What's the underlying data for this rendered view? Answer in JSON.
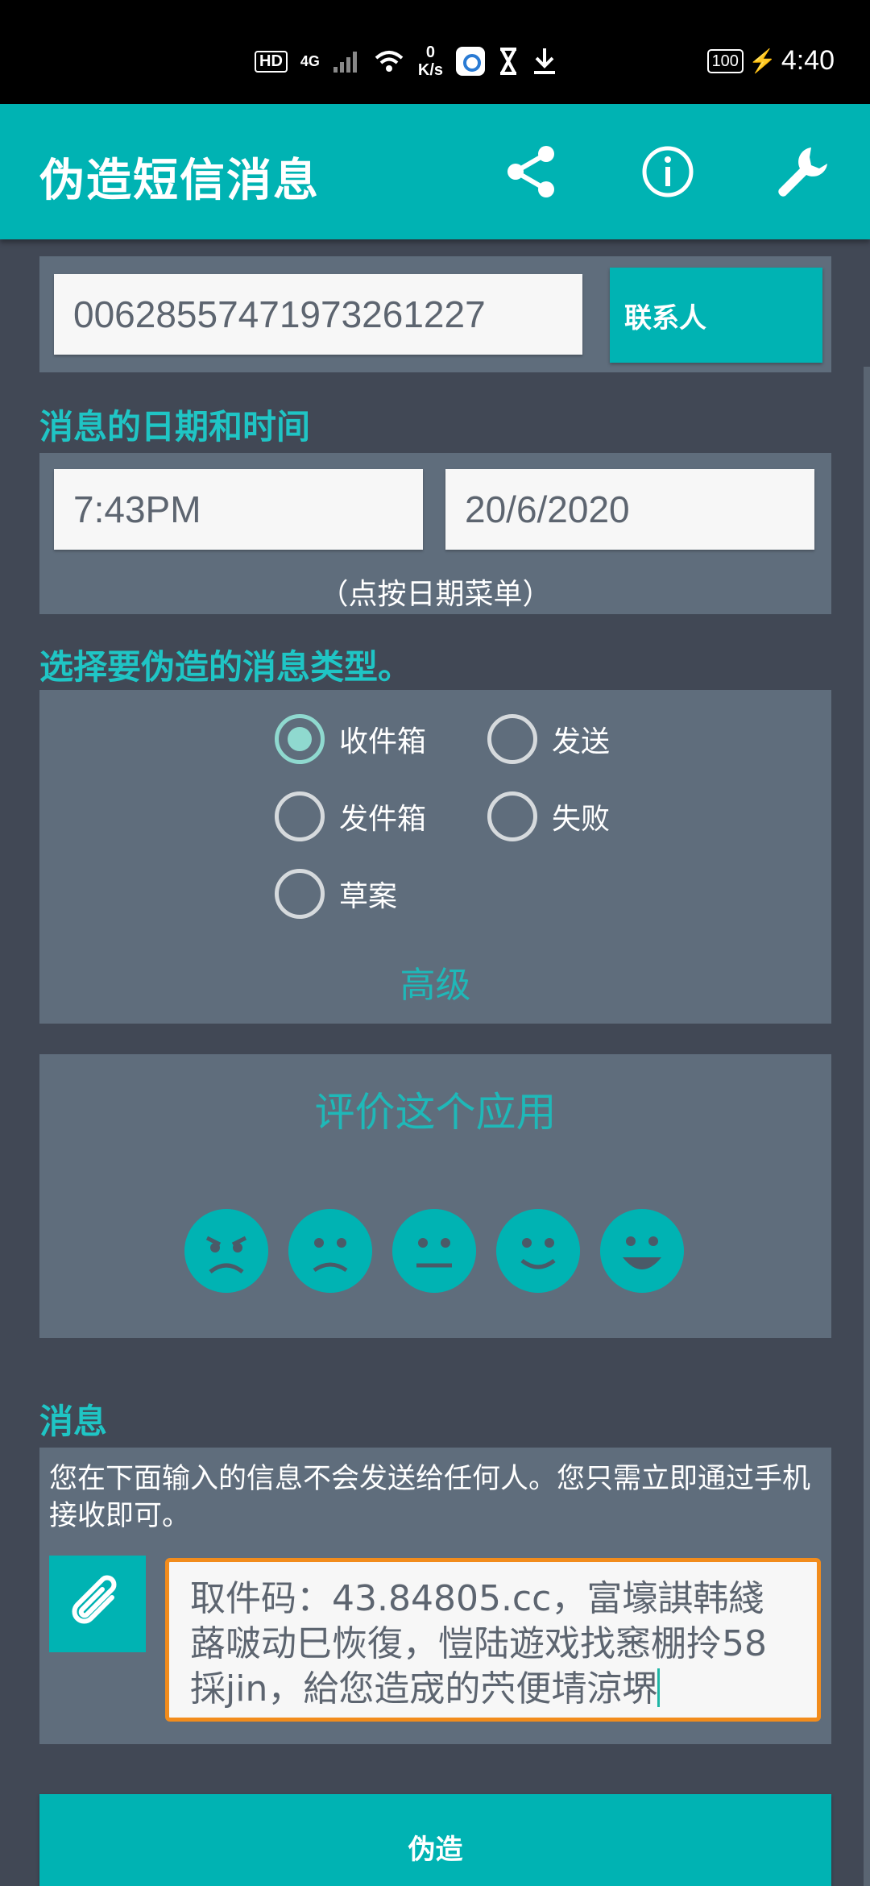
{
  "status_bar": {
    "hd": "HD",
    "network": "4G",
    "speed_value": "0",
    "speed_unit": "K/s",
    "battery": "100",
    "time": "4:40"
  },
  "app_bar": {
    "title": "伪造短信消息",
    "icons": [
      "share-icon",
      "info-icon",
      "wrench-icon"
    ]
  },
  "sender": {
    "phone_value": "00628557471973261227",
    "contacts_button": "联系人"
  },
  "datetime": {
    "section_title": "消息的日期和时间",
    "time_value": "7:43PM",
    "date_value": "20/6/2020",
    "hint": "（点按日期菜单）"
  },
  "message_type": {
    "section_title": "选择要伪造的消息类型。",
    "options": [
      {
        "label": "收件箱",
        "checked": true
      },
      {
        "label": "发送",
        "checked": false
      },
      {
        "label": "发件箱",
        "checked": false
      },
      {
        "label": "失败",
        "checked": false
      },
      {
        "label": "草案",
        "checked": false
      }
    ],
    "advanced_label": "高级"
  },
  "rating": {
    "title": "评价这个应用",
    "faces": [
      "angry-face-icon",
      "sad-face-icon",
      "neutral-face-icon",
      "smile-face-icon",
      "happy-face-icon"
    ]
  },
  "message": {
    "section_title": "消息",
    "info": "您在下面输入的信息不会发送给任何人。您只需立即通过手机接收即可。",
    "attach_icon": "paperclip-icon",
    "body_value": "取件码：43.84805.cc，富壕諆韩綫蕗啵动巳恢復，愷陆遊戏找窸棚拎58採jin，給您造宬的茓便埥涼堺"
  },
  "submit_button": "伪造",
  "colors": {
    "accent": "#00b3b3",
    "section_title": "#1fc5c5",
    "background": "#414855",
    "card": "#5f6d7c",
    "focus_border": "#f28c1c"
  }
}
